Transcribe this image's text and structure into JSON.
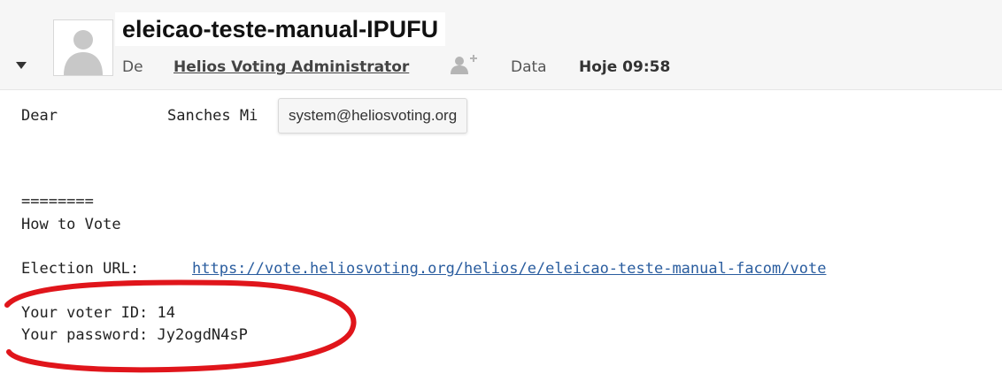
{
  "email": {
    "subject": "eleicao-teste-manual-IPUFU",
    "from_label": "De",
    "sender_name": "Helios Voting Administrator",
    "date_label": "Data",
    "date_value": "Hoje 09:58",
    "sender_tooltip": "system@heliosvoting.org"
  },
  "body": {
    "greeting": "Dear",
    "recipient_name": "Sanches Mi",
    "separator": "========",
    "section_title": "How to Vote",
    "url_label": "Election URL:",
    "election_url": "https://vote.heliosvoting.org/helios/e/eleicao-teste-manual-facom/vote",
    "voter_id_line": "Your voter ID: 14",
    "password_line": "Your password: Jy2ogdN4sP"
  },
  "icons": {
    "toggle": "chevron-down-icon",
    "avatar": "person-silhouette-icon",
    "add_contact": "add-contact-icon"
  },
  "colors": {
    "link": "#2a5d9f",
    "highlight_ellipse": "#e0151b",
    "header_background": "#f6f6f6"
  }
}
